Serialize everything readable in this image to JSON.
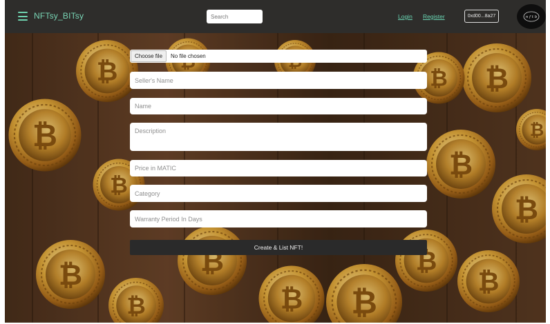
{
  "navbar": {
    "brand": "NFTsy_BITsy",
    "search_placeholder": "Search",
    "login_label": "Login",
    "register_label": "Register",
    "wallet_address": "0xd00...8a27",
    "accent_color": "#6ad6b4"
  },
  "form": {
    "file_button_label": "Choose file",
    "file_status": "No file chosen",
    "seller_name_placeholder": "Seller's Name",
    "name_placeholder": "Name",
    "description_placeholder": "Description",
    "price_placeholder": "Price in MATIC",
    "category_placeholder": "Category",
    "warranty_placeholder": "Warranty Period In Days",
    "submit_label": "Create & List NFT!"
  },
  "background": {
    "theme": "gold bitcoin coins on wooden table"
  }
}
